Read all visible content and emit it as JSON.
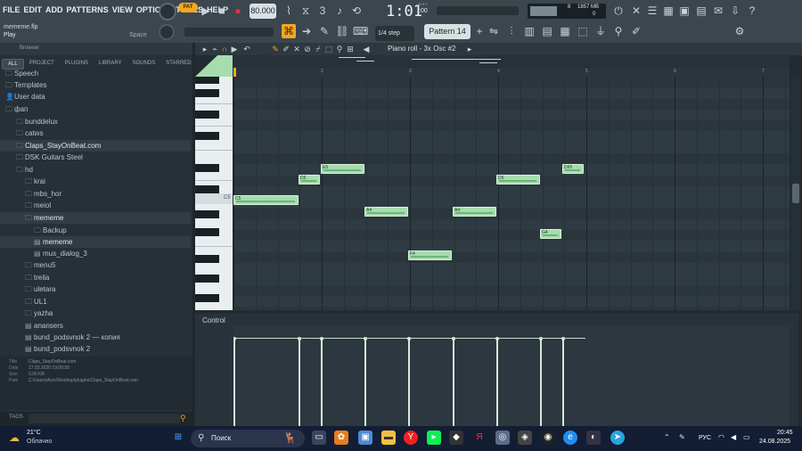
{
  "menu": [
    "FILE",
    "EDIT",
    "ADD",
    "PATTERNS",
    "VIEW",
    "OPTIONS",
    "TOOLS",
    "HELP"
  ],
  "project": {
    "file": "mememe.flp",
    "status": "Play",
    "hint": "Space"
  },
  "transport": {
    "pat_label": "PAT",
    "tempo": "80.000",
    "time": "1:01",
    "time_small": ":00",
    "time_sup": "B.S.T",
    "cpu": "8",
    "mem": "1857 MB",
    "voices": "0"
  },
  "pattern": {
    "snap": "1/4 step",
    "name": "Pattern 14"
  },
  "pianoroll": {
    "title": "Piano roll - 3x Osc #2",
    "control_label": "Control",
    "key_label": "C5"
  },
  "browser": {
    "header": "Browser",
    "tabs": [
      "ALL",
      "PROJECT",
      "PLUGINS",
      "LIBRARY",
      "SOUNDS",
      "STARRED"
    ],
    "items": [
      {
        "label": "Speech",
        "icon": "folder"
      },
      {
        "label": "Templates",
        "icon": "folder"
      },
      {
        "label": "User data",
        "icon": "user"
      },
      {
        "label": "фап",
        "icon": "folder"
      },
      {
        "label": "bunddelux",
        "icon": "folder"
      },
      {
        "label": "catws",
        "icon": "folder"
      },
      {
        "label": "Claps_StayOnBeat.com",
        "icon": "folder"
      },
      {
        "label": "DSK Guitars Steel",
        "icon": "folder"
      },
      {
        "label": "hd",
        "icon": "folder"
      },
      {
        "label": "krai",
        "icon": "folder"
      },
      {
        "label": "mbs_hor",
        "icon": "folder"
      },
      {
        "label": "meiol",
        "icon": "folder"
      },
      {
        "label": "mememe",
        "icon": "folder"
      },
      {
        "label": "Backup",
        "icon": "folder"
      },
      {
        "label": "mememe",
        "icon": "file"
      },
      {
        "label": "mus_dialog_3",
        "icon": "file"
      },
      {
        "label": "menu5",
        "icon": "folder"
      },
      {
        "label": "treila",
        "icon": "folder"
      },
      {
        "label": "uletara",
        "icon": "folder"
      },
      {
        "label": "UL1",
        "icon": "folder"
      },
      {
        "label": "yazha",
        "icon": "folder"
      },
      {
        "label": "anansers",
        "icon": "file"
      },
      {
        "label": "bund_podsvnok 2 — копия",
        "icon": "file"
      },
      {
        "label": "bund_podsvnok 2",
        "icon": "file"
      }
    ],
    "info": {
      "title_label": "Title",
      "title": "Claps_StayOnBeat.com",
      "date_label": "Date",
      "date": "17.03.2020 19:00:58",
      "size_label": "Size",
      "size": "0.00 KB",
      "path_label": "Path",
      "path": "C:\\Users\\Acer\\Desktop\\plugins\\Claps_StayOnBeat.com"
    },
    "tags_label": "TAGS"
  },
  "timeline_numbers": [
    "2",
    "3",
    "4",
    "5",
    "6",
    "7"
  ],
  "notes": [
    {
      "label": "C5"
    },
    {
      "label": "D5"
    },
    {
      "label": "E5"
    },
    {
      "label": "A4"
    },
    {
      "label": "F4"
    },
    {
      "label": "A4"
    },
    {
      "label": "D5"
    },
    {
      "label": "G4"
    },
    {
      "label": "D#5"
    }
  ],
  "taskbar": {
    "weather_temp": "21°C",
    "weather_desc": "Облачно",
    "search_placeholder": "Поиск",
    "lang": "РУС",
    "time": "20:45",
    "date": "24.08.2025"
  },
  "colors": {
    "accent": "#a6dcae",
    "topbar": "#3b464e",
    "background": "#1e262c",
    "taskbar": "#131d33"
  }
}
